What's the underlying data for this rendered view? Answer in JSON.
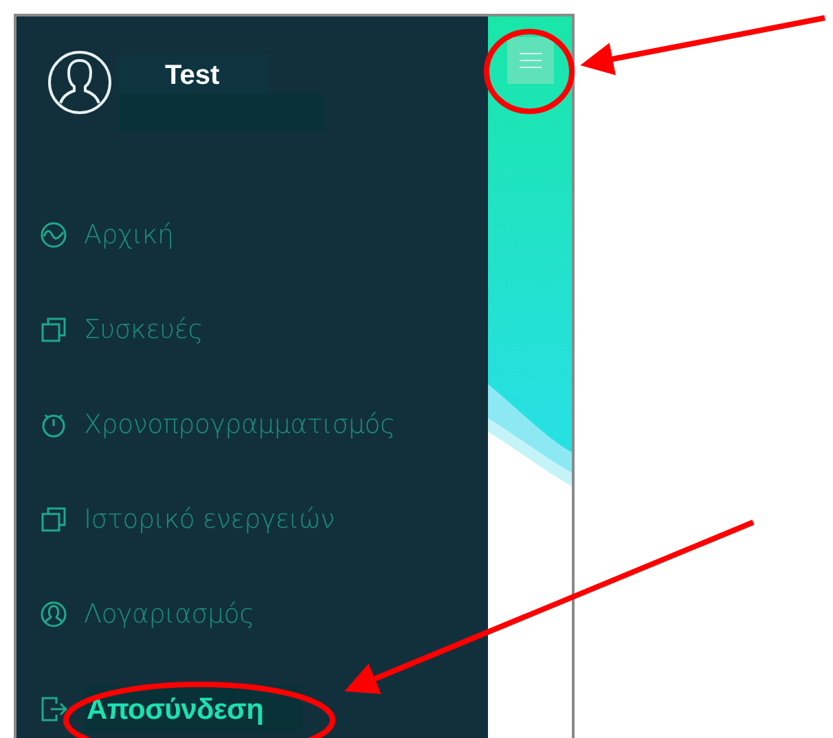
{
  "drawer": {
    "user": {
      "name": "Test"
    },
    "items": [
      {
        "label": "Αρχική",
        "kind": "chart",
        "selected": false
      },
      {
        "label": "Συσκευές",
        "kind": "copy",
        "selected": false
      },
      {
        "label": "Χρονοπρογραμματισμός",
        "kind": "timer",
        "selected": false
      },
      {
        "label": "Ιστορικό ενεργειών",
        "kind": "copy",
        "selected": false
      },
      {
        "label": "Λογαριασμός",
        "kind": "user",
        "selected": false
      },
      {
        "label": "Αποσύνδεση",
        "kind": "logout",
        "selected": true
      }
    ]
  }
}
